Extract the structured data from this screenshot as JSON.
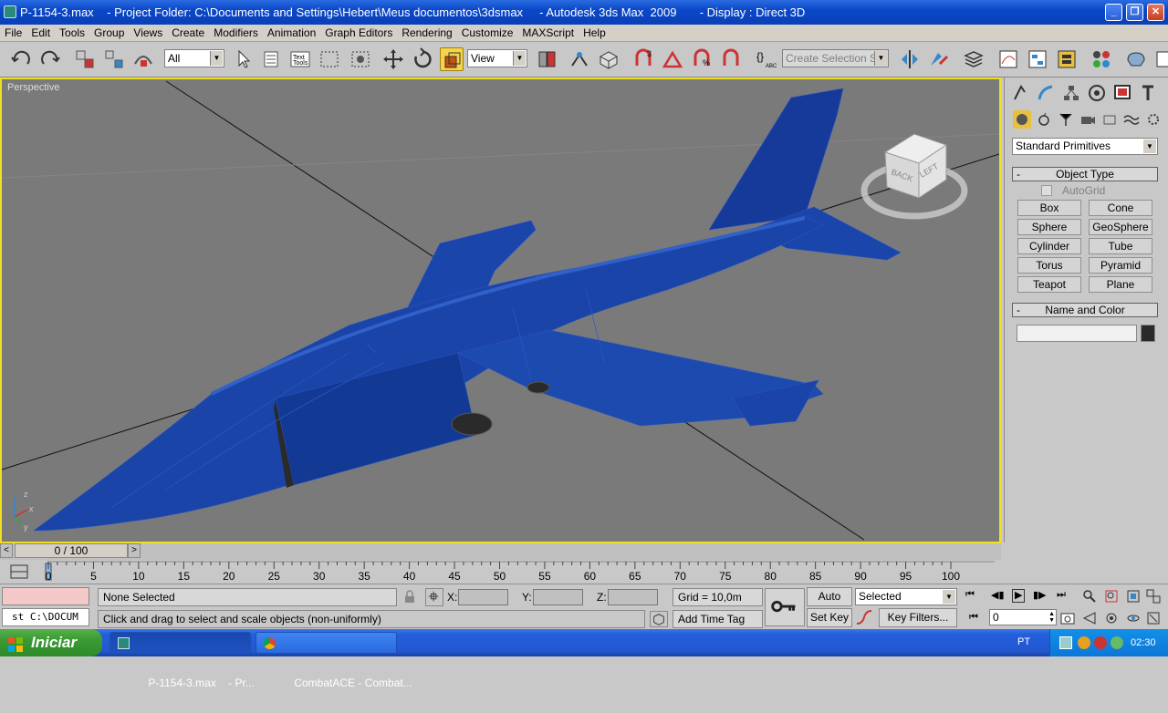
{
  "window": {
    "title": "P-1154-3.max    - Project Folder: C:\\Documents and Settings\\Hebert\\Meus documentos\\3dsmax     - Autodesk 3ds Max  2009       - Display : Direct 3D"
  },
  "menu": [
    "File",
    "Edit",
    "Tools",
    "Group",
    "Views",
    "Create",
    "Modifiers",
    "Animation",
    "Graph Editors",
    "Rendering",
    "Customize",
    "MAXScript",
    "Help"
  ],
  "toolbar": {
    "filter_value": "All",
    "refcoord_value": "View",
    "selection_set_placeholder": "Create Selection Set"
  },
  "viewport": {
    "label": "Perspective",
    "viewcube_labels": [
      "BACK",
      "LEFT"
    ],
    "axis_labels": [
      "x",
      "y",
      "z"
    ],
    "model": "blue jet aircraft wireframe-shaded"
  },
  "command_panel": {
    "category_value": "Standard Primitives",
    "object_type_title": "Object Type",
    "autogrid_label": "AutoGrid",
    "primitives": [
      "Box",
      "Cone",
      "Sphere",
      "GeoSphere",
      "Cylinder",
      "Tube",
      "Torus",
      "Pyramid",
      "Teapot",
      "Plane"
    ],
    "name_color_title": "Name and Color"
  },
  "timeline": {
    "frame_readout": "0 / 100",
    "ticks": [
      "0",
      "5",
      "10",
      "15",
      "20",
      "25",
      "30",
      "35",
      "40",
      "45",
      "50",
      "55",
      "60",
      "65",
      "70",
      "75",
      "80",
      "85",
      "90",
      "95",
      "100"
    ]
  },
  "status": {
    "listener_text": "st C:\\DOCUM",
    "selection_info": "None Selected",
    "prompt": "Click and drag to select and scale objects (non-uniformly)",
    "x_label": "X:",
    "y_label": "Y:",
    "z_label": "Z:",
    "grid": "Grid = 10,0m",
    "add_time_tag": "Add Time Tag",
    "auto_key": "Auto Key",
    "set_key": "Set Key",
    "key_mode_value": "Selected",
    "key_filters": "Key Filters...",
    "current_frame": "0"
  },
  "taskbar": {
    "start_label": "Iniciar",
    "tasks": [
      "P-1154-3.max    - Pr...",
      "CombatACE - Combat..."
    ],
    "language": "PT",
    "clock": "02:30"
  },
  "colors": {
    "viewport_bg": "#7a7a7a",
    "model_blue": "#1840a0",
    "active_border": "#f0e020",
    "titlebar": "#0a48c8"
  }
}
